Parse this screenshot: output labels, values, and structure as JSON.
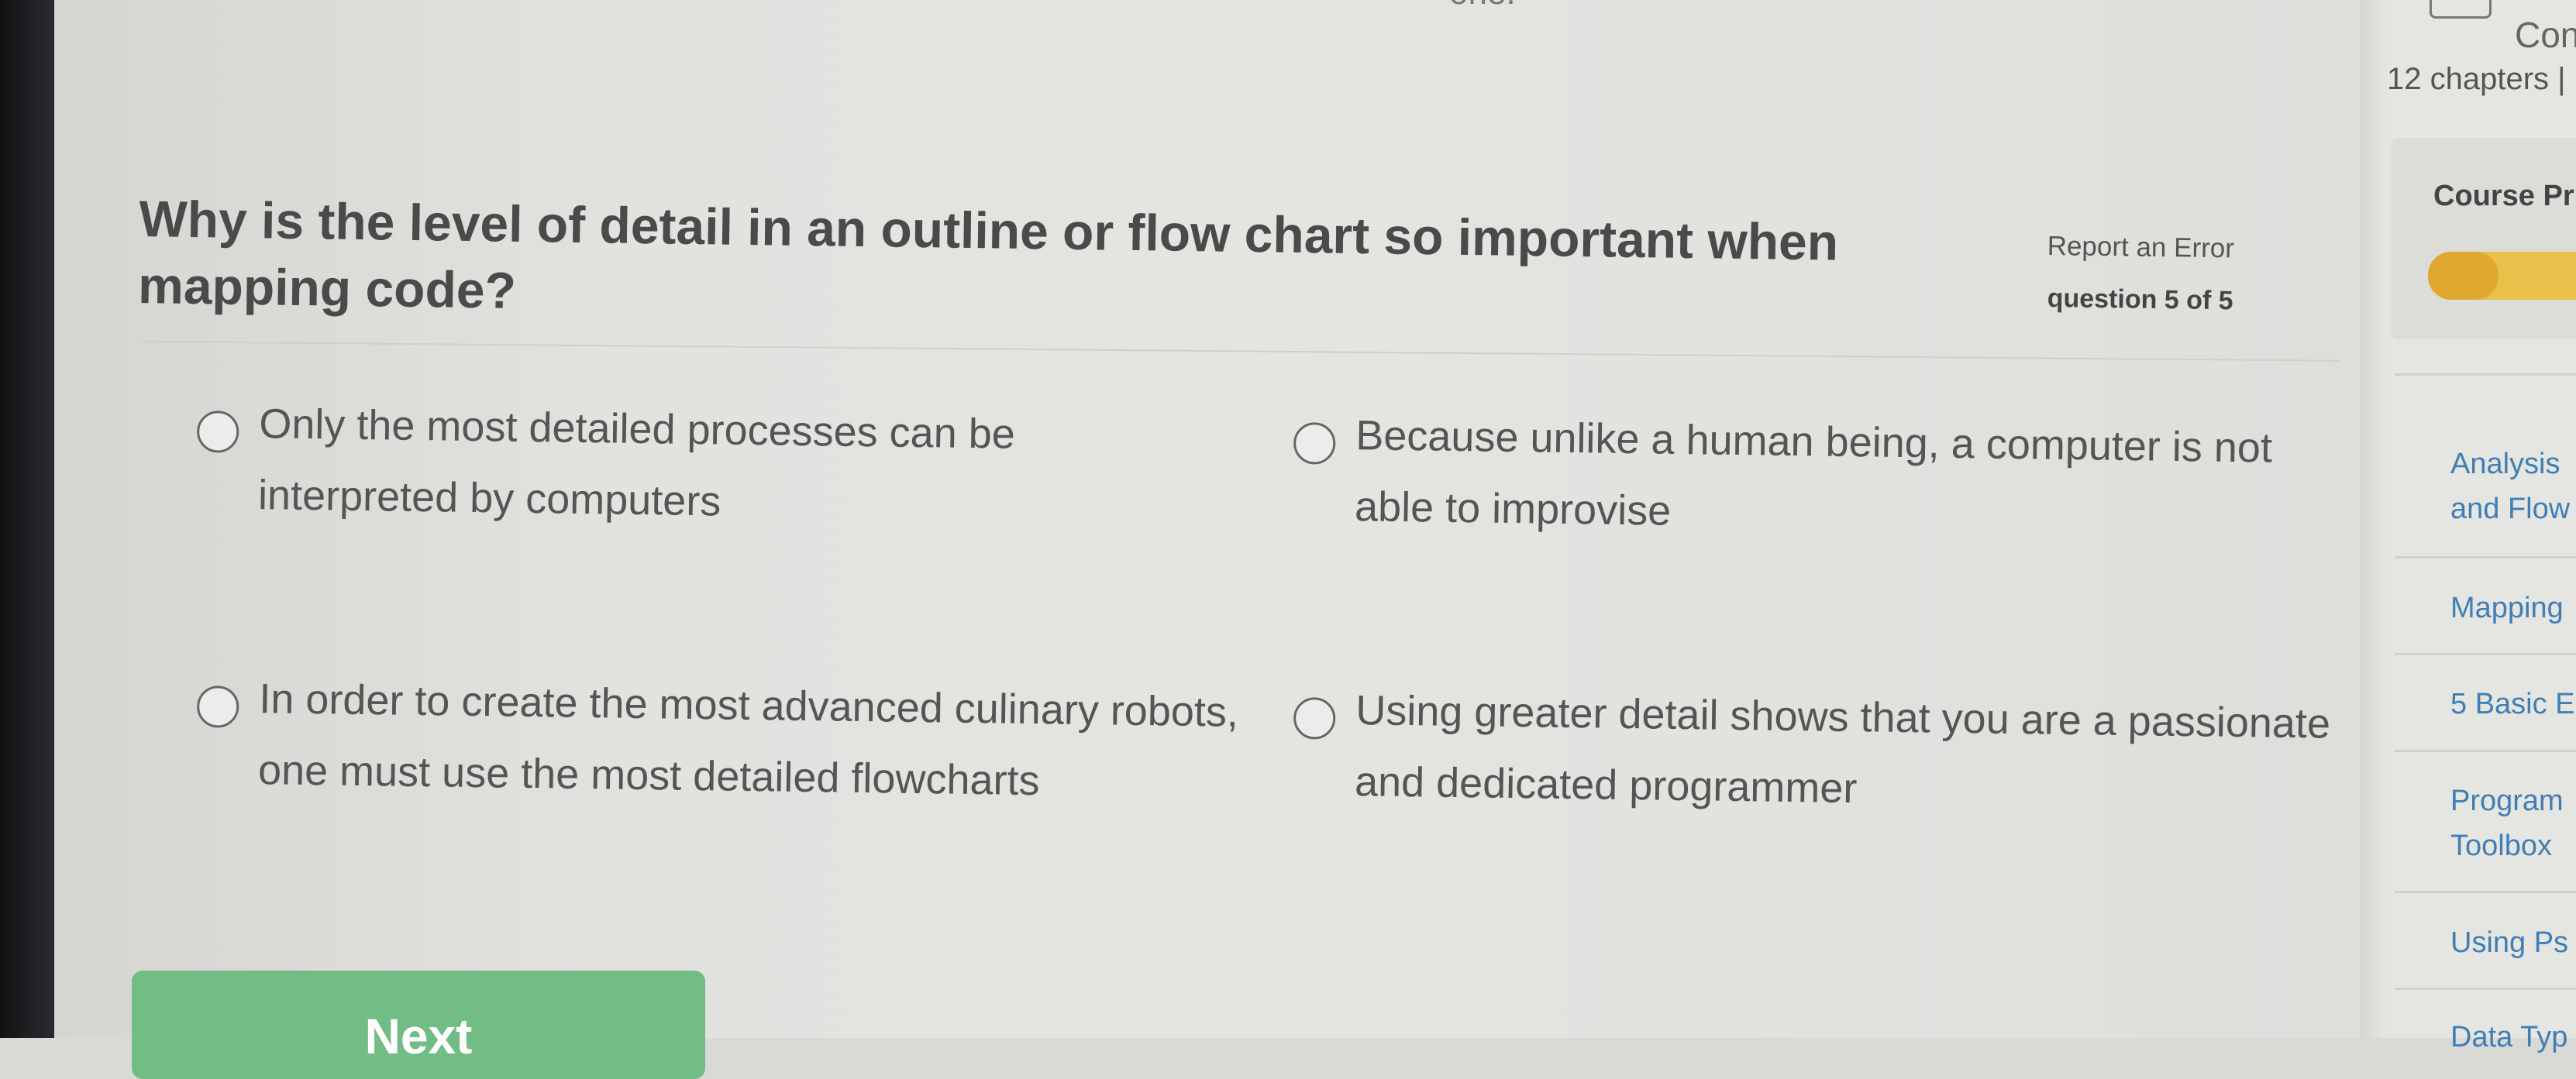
{
  "page_top_fragment": "one.",
  "question": {
    "text": "Why is the level of detail in an outline or flow chart so important when mapping code?",
    "report_link": "Report an Error",
    "count": "question 5 of 5"
  },
  "options": [
    {
      "label": "Only the most detailed processes can be interpreted by computers"
    },
    {
      "label": "Because unlike a human being, a computer is not able to improvise"
    },
    {
      "label": "In order to create the most advanced culinary robots, one must use the most detailed flowcharts"
    },
    {
      "label": "Using greater detail shows that you are a passionate and dedicated programmer"
    }
  ],
  "next_button": {
    "label": "Next"
  },
  "sidebar": {
    "course_title": "Con",
    "chapters": "12 chapters |",
    "progress_label": "Course Pr",
    "progress_fraction": 0.35,
    "nav": [
      {
        "line1": "Analysis",
        "line2": "and Flow"
      },
      {
        "line1": "Mapping",
        "line2": ""
      },
      {
        "line1": "5 Basic E",
        "line2": ""
      },
      {
        "line1": "Program",
        "line2": "Toolbox"
      },
      {
        "line1": "Using Ps",
        "line2": ""
      },
      {
        "line1": "Data Typ",
        "line2": ""
      }
    ]
  },
  "colors": {
    "next_button": "#72bc86",
    "link": "#3f7fb5",
    "progress": "#e0a82e"
  },
  "icons": [
    "book-icon",
    "radio-circle-icon"
  ]
}
